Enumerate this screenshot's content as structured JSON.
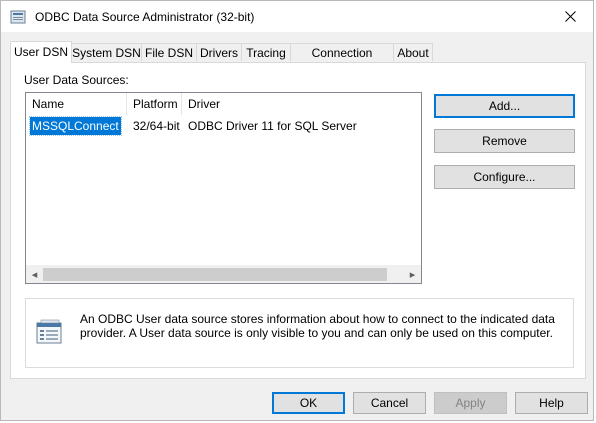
{
  "window": {
    "title": "ODBC Data Source Administrator (32-bit)",
    "close_glyph": "✕"
  },
  "tabs": [
    {
      "label": "User DSN",
      "active": true
    },
    {
      "label": "System DSN"
    },
    {
      "label": "File DSN"
    },
    {
      "label": "Drivers"
    },
    {
      "label": "Tracing"
    },
    {
      "label": "Connection Pooling"
    },
    {
      "label": "About"
    }
  ],
  "user_dsn": {
    "section_label": "User Data Sources:",
    "columns": [
      "Name",
      "Platform",
      "Driver"
    ],
    "rows": [
      {
        "name": "MSSQLConnect",
        "platform": "32/64-bit",
        "driver": "ODBC Driver 11 for SQL Server",
        "selected": true
      }
    ],
    "buttons": {
      "add": "Add...",
      "remove": "Remove",
      "configure": "Configure..."
    },
    "description": "An ODBC User data source stores information about how to connect to the indicated data provider.   A User data source is only visible to you and can only be used on this computer."
  },
  "footer": {
    "ok": "OK",
    "cancel": "Cancel",
    "apply": "Apply",
    "help": "Help"
  },
  "colors": {
    "accent": "#0078d7",
    "selection": "#0078d7",
    "window_bg": "#f0f0f0"
  },
  "icons": {
    "app": "odbc-admin-icon",
    "description": "data-source-icon",
    "scroll_left": "◂",
    "scroll_right": "▸"
  }
}
